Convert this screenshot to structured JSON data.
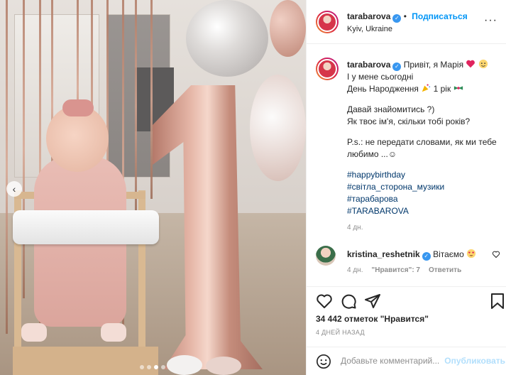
{
  "post": {
    "username": "tarabarova",
    "follow_label": "Подписаться",
    "location": "Kyiv, Ukraine",
    "caption": {
      "line1": "Привіт, я Марія",
      "line2": "І у мене сьогодні",
      "line3_a": "День Народження",
      "line3_b": "1 рік",
      "line4": "Давай знайомитись ?)",
      "line5": "Як твоє ім'я, скільки тобі років?",
      "line6": "P.s.: не передати словами, як ми тебе любимо ...☺",
      "hashtags": [
        "#happybirthday",
        "#світла_сторона_музики",
        "#тарабарова",
        "#TARABAROVA"
      ],
      "time": "4 дн."
    },
    "comment": {
      "username": "kristina_reshetnik",
      "text": "Вітаємо",
      "time": "4 дн.",
      "likes": "\"Нравится\": 7",
      "reply_label": "Ответить"
    },
    "likes_text": "34 442 отметок \"Нравится\"",
    "date_text": "4 ДНЕЙ НАЗАД",
    "comment_placeholder": "Добавьте комментарий...",
    "publish_label": "Опубликовать"
  },
  "carousel": {
    "slides": 4,
    "active": 3
  },
  "colors": {
    "accent": "#0095f6",
    "verified": "#3897f0",
    "link": "#00376b",
    "muted": "#8e8e8e"
  },
  "icons": [
    "verified-icon",
    "heart-icon",
    "comment-icon",
    "share-icon",
    "bookmark-icon",
    "emoji-icon",
    "more-icon",
    "chevron-left-icon"
  ]
}
